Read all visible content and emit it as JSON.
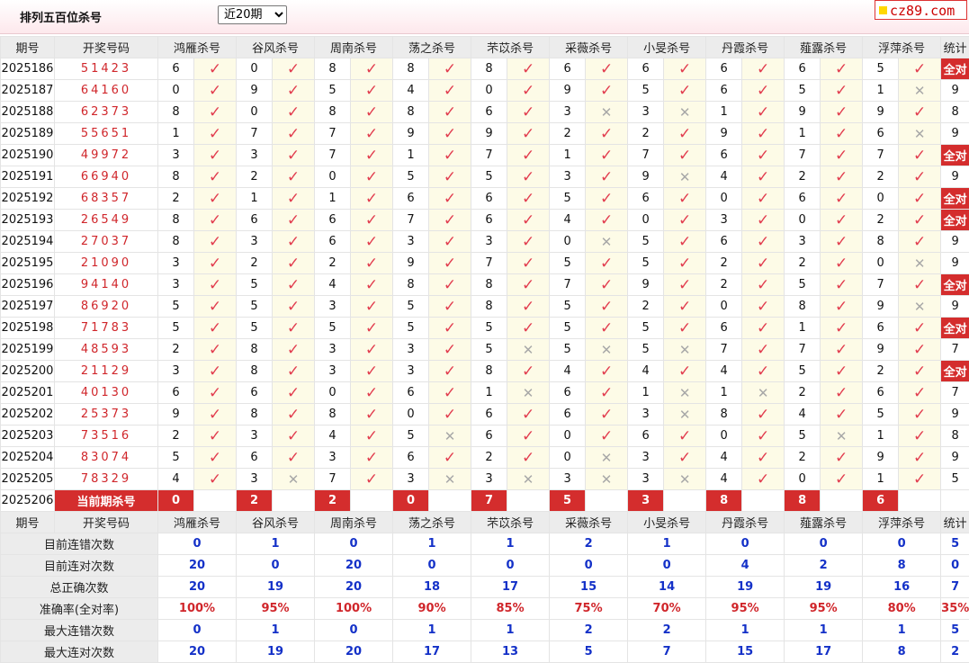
{
  "header": {
    "title": "排列五百位杀号",
    "period_select": "近20期",
    "logo_text": "cz89.com"
  },
  "columns": {
    "period": "期号",
    "draw": "开奖号码",
    "experts": [
      "鸿雁杀号",
      "谷风杀号",
      "周南杀号",
      "荡之杀号",
      "芣苡杀号",
      "采薇杀号",
      "小旻杀号",
      "丹霞杀号",
      "薤露杀号",
      "浮萍杀号"
    ],
    "stats": "统计"
  },
  "rows": [
    {
      "period": "2025186",
      "draw": "51423",
      "kills": [
        "6",
        "0",
        "8",
        "8",
        "8",
        "6",
        "6",
        "6",
        "6",
        "5"
      ],
      "marks": [
        "✓",
        "✓",
        "✓",
        "✓",
        "✓",
        "✓",
        "✓",
        "✓",
        "✓",
        "✓"
      ],
      "stat": "全对"
    },
    {
      "period": "2025187",
      "draw": "64160",
      "kills": [
        "0",
        "9",
        "5",
        "4",
        "0",
        "9",
        "5",
        "6",
        "5",
        "1"
      ],
      "marks": [
        "✓",
        "✓",
        "✓",
        "✓",
        "✓",
        "✓",
        "✓",
        "✓",
        "✓",
        "✕"
      ],
      "stat": "9"
    },
    {
      "period": "2025188",
      "draw": "62373",
      "kills": [
        "8",
        "0",
        "8",
        "8",
        "6",
        "3",
        "3",
        "1",
        "9",
        "9"
      ],
      "marks": [
        "✓",
        "✓",
        "✓",
        "✓",
        "✓",
        "✕",
        "✕",
        "✓",
        "✓",
        "✓"
      ],
      "stat": "8"
    },
    {
      "period": "2025189",
      "draw": "55651",
      "kills": [
        "1",
        "7",
        "7",
        "9",
        "9",
        "2",
        "2",
        "9",
        "1",
        "6"
      ],
      "marks": [
        "✓",
        "✓",
        "✓",
        "✓",
        "✓",
        "✓",
        "✓",
        "✓",
        "✓",
        "✕"
      ],
      "stat": "9"
    },
    {
      "period": "2025190",
      "draw": "49972",
      "kills": [
        "3",
        "3",
        "7",
        "1",
        "7",
        "1",
        "7",
        "6",
        "7",
        "7"
      ],
      "marks": [
        "✓",
        "✓",
        "✓",
        "✓",
        "✓",
        "✓",
        "✓",
        "✓",
        "✓",
        "✓"
      ],
      "stat": "全对"
    },
    {
      "period": "2025191",
      "draw": "66940",
      "kills": [
        "8",
        "2",
        "0",
        "5",
        "5",
        "3",
        "9",
        "4",
        "2",
        "2"
      ],
      "marks": [
        "✓",
        "✓",
        "✓",
        "✓",
        "✓",
        "✓",
        "✕",
        "✓",
        "✓",
        "✓"
      ],
      "stat": "9"
    },
    {
      "period": "2025192",
      "draw": "68357",
      "kills": [
        "2",
        "1",
        "1",
        "6",
        "6",
        "5",
        "6",
        "0",
        "6",
        "0"
      ],
      "marks": [
        "✓",
        "✓",
        "✓",
        "✓",
        "✓",
        "✓",
        "✓",
        "✓",
        "✓",
        "✓"
      ],
      "stat": "全对"
    },
    {
      "period": "2025193",
      "draw": "26549",
      "kills": [
        "8",
        "6",
        "6",
        "7",
        "6",
        "4",
        "0",
        "3",
        "0",
        "2"
      ],
      "marks": [
        "✓",
        "✓",
        "✓",
        "✓",
        "✓",
        "✓",
        "✓",
        "✓",
        "✓",
        "✓"
      ],
      "stat": "全对"
    },
    {
      "period": "2025194",
      "draw": "27037",
      "kills": [
        "8",
        "3",
        "6",
        "3",
        "3",
        "0",
        "5",
        "6",
        "3",
        "8"
      ],
      "marks": [
        "✓",
        "✓",
        "✓",
        "✓",
        "✓",
        "✕",
        "✓",
        "✓",
        "✓",
        "✓"
      ],
      "stat": "9"
    },
    {
      "period": "2025195",
      "draw": "21090",
      "kills": [
        "3",
        "2",
        "2",
        "9",
        "7",
        "5",
        "5",
        "2",
        "2",
        "0"
      ],
      "marks": [
        "✓",
        "✓",
        "✓",
        "✓",
        "✓",
        "✓",
        "✓",
        "✓",
        "✓",
        "✕"
      ],
      "stat": "9"
    },
    {
      "period": "2025196",
      "draw": "94140",
      "kills": [
        "3",
        "5",
        "4",
        "8",
        "8",
        "7",
        "9",
        "2",
        "5",
        "7"
      ],
      "marks": [
        "✓",
        "✓",
        "✓",
        "✓",
        "✓",
        "✓",
        "✓",
        "✓",
        "✓",
        "✓"
      ],
      "stat": "全对"
    },
    {
      "period": "2025197",
      "draw": "86920",
      "kills": [
        "5",
        "5",
        "3",
        "5",
        "8",
        "5",
        "2",
        "0",
        "8",
        "9"
      ],
      "marks": [
        "✓",
        "✓",
        "✓",
        "✓",
        "✓",
        "✓",
        "✓",
        "✓",
        "✓",
        "✕"
      ],
      "stat": "9"
    },
    {
      "period": "2025198",
      "draw": "71783",
      "kills": [
        "5",
        "5",
        "5",
        "5",
        "5",
        "5",
        "5",
        "6",
        "1",
        "6"
      ],
      "marks": [
        "✓",
        "✓",
        "✓",
        "✓",
        "✓",
        "✓",
        "✓",
        "✓",
        "✓",
        "✓"
      ],
      "stat": "全对"
    },
    {
      "period": "2025199",
      "draw": "48593",
      "kills": [
        "2",
        "8",
        "3",
        "3",
        "5",
        "5",
        "5",
        "7",
        "7",
        "9"
      ],
      "marks": [
        "✓",
        "✓",
        "✓",
        "✓",
        "✕",
        "✕",
        "✕",
        "✓",
        "✓",
        "✓"
      ],
      "stat": "7"
    },
    {
      "period": "2025200",
      "draw": "21129",
      "kills": [
        "3",
        "8",
        "3",
        "3",
        "8",
        "4",
        "4",
        "4",
        "5",
        "2"
      ],
      "marks": [
        "✓",
        "✓",
        "✓",
        "✓",
        "✓",
        "✓",
        "✓",
        "✓",
        "✓",
        "✓"
      ],
      "stat": "全对"
    },
    {
      "period": "2025201",
      "draw": "40130",
      "kills": [
        "6",
        "6",
        "0",
        "6",
        "1",
        "6",
        "1",
        "1",
        "2",
        "6"
      ],
      "marks": [
        "✓",
        "✓",
        "✓",
        "✓",
        "✕",
        "✓",
        "✕",
        "✕",
        "✓",
        "✓"
      ],
      "stat": "7"
    },
    {
      "period": "2025202",
      "draw": "25373",
      "kills": [
        "9",
        "8",
        "8",
        "0",
        "6",
        "6",
        "3",
        "8",
        "4",
        "5"
      ],
      "marks": [
        "✓",
        "✓",
        "✓",
        "✓",
        "✓",
        "✓",
        "✕",
        "✓",
        "✓",
        "✓"
      ],
      "stat": "9"
    },
    {
      "period": "2025203",
      "draw": "73516",
      "kills": [
        "2",
        "3",
        "4",
        "5",
        "6",
        "0",
        "6",
        "0",
        "5",
        "1"
      ],
      "marks": [
        "✓",
        "✓",
        "✓",
        "✕",
        "✓",
        "✓",
        "✓",
        "✓",
        "✕",
        "✓"
      ],
      "stat": "8"
    },
    {
      "period": "2025204",
      "draw": "83074",
      "kills": [
        "5",
        "6",
        "3",
        "6",
        "2",
        "0",
        "3",
        "4",
        "2",
        "9"
      ],
      "marks": [
        "✓",
        "✓",
        "✓",
        "✓",
        "✓",
        "✕",
        "✓",
        "✓",
        "✓",
        "✓"
      ],
      "stat": "9"
    },
    {
      "period": "2025205",
      "draw": "78329",
      "kills": [
        "4",
        "3",
        "7",
        "3",
        "3",
        "3",
        "3",
        "4",
        "0",
        "1"
      ],
      "marks": [
        "✓",
        "✕",
        "✓",
        "✕",
        "✕",
        "✕",
        "✕",
        "✓",
        "✓",
        "✓"
      ],
      "stat": "5"
    }
  ],
  "current": {
    "period": "2025206",
    "label": "当前期杀号",
    "kills": [
      "0",
      "2",
      "2",
      "0",
      "7",
      "5",
      "3",
      "8",
      "8",
      "6"
    ]
  },
  "summary": [
    {
      "label": "目前连错次数",
      "values": [
        "0",
        "1",
        "0",
        "1",
        "1",
        "2",
        "1",
        "0",
        "0",
        "0"
      ],
      "stat": "5"
    },
    {
      "label": "目前连对次数",
      "values": [
        "20",
        "0",
        "20",
        "0",
        "0",
        "0",
        "0",
        "4",
        "2",
        "8"
      ],
      "stat": "0"
    },
    {
      "label": "总正确次数",
      "values": [
        "20",
        "19",
        "20",
        "18",
        "17",
        "15",
        "14",
        "19",
        "19",
        "16"
      ],
      "stat": "7"
    },
    {
      "label": "准确率(全对率)",
      "values": [
        "100%",
        "95%",
        "100%",
        "90%",
        "85%",
        "75%",
        "70%",
        "95%",
        "95%",
        "80%"
      ],
      "stat": "35%",
      "accent": true
    },
    {
      "label": "最大连错次数",
      "values": [
        "0",
        "1",
        "0",
        "1",
        "1",
        "2",
        "2",
        "1",
        "1",
        "1"
      ],
      "stat": "5"
    },
    {
      "label": "最大连对次数",
      "values": [
        "20",
        "19",
        "20",
        "17",
        "13",
        "5",
        "7",
        "15",
        "17",
        "8"
      ],
      "stat": "2"
    }
  ],
  "colors": {
    "accent_red": "#d42d2d",
    "check_red": "#e23d4f",
    "blue_value": "#1431c8",
    "cross_gray": "#a8a8a8"
  }
}
